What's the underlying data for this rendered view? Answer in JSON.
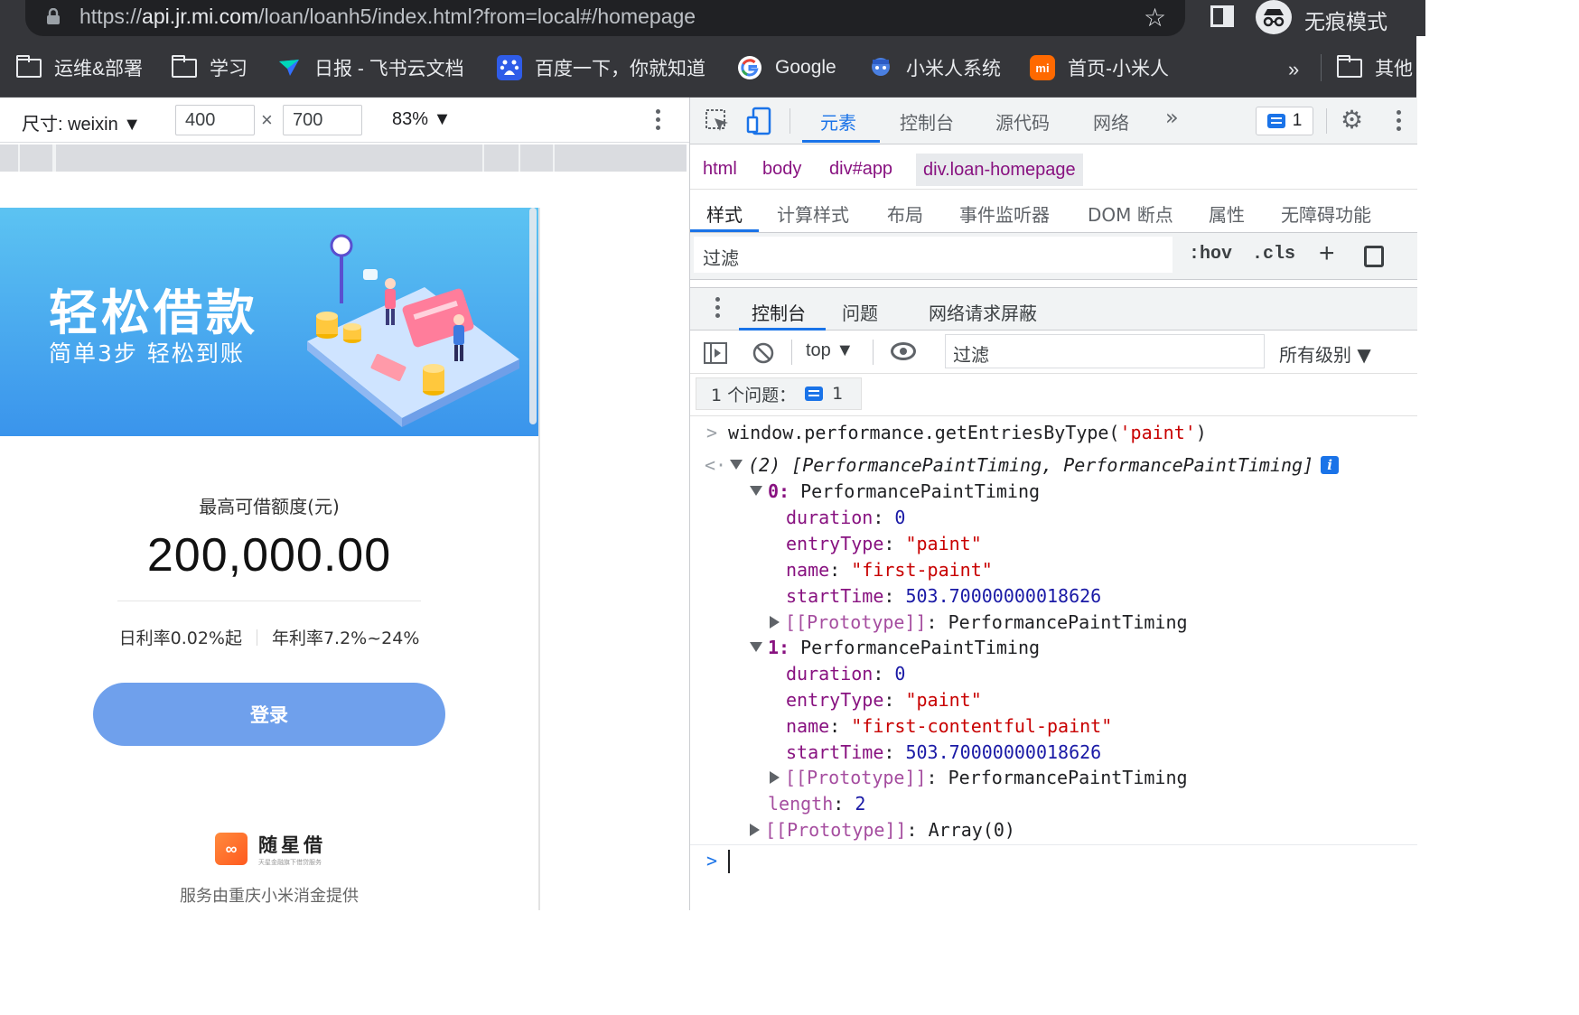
{
  "browser": {
    "url_scheme": "https://",
    "url_host": "api.jr.mi.com",
    "url_path": "/loan/loanh5/index.html?from=local#/homepage",
    "incognito_label": "无痕模式",
    "icons": [
      "lock-icon",
      "star-icon",
      "side-panel-icon",
      "incognito-icon"
    ]
  },
  "bookmarks": {
    "items": [
      {
        "label": "运维&部署",
        "icon": "folder-icon"
      },
      {
        "label": "学习",
        "icon": "folder-icon"
      },
      {
        "label": "日报 - 飞书云文档",
        "icon": "feishu-icon"
      },
      {
        "label": "百度一下，你就知道",
        "icon": "baidu-icon"
      },
      {
        "label": "Google",
        "icon": "google-icon"
      },
      {
        "label": "小米人系统",
        "icon": "mi-people-icon"
      },
      {
        "label": "首页-小米人",
        "icon": "mi-logo-icon"
      }
    ],
    "more": "»",
    "other_label": "其他"
  },
  "device_toolbar": {
    "dimensions_label": "尺寸: weixin ▼",
    "width": "400",
    "height": "700",
    "times": "×",
    "zoom": "83% ▼"
  },
  "page": {
    "banner_title": "轻松借款",
    "banner_subtitle": "简单3步   轻松到账",
    "limit_label": "最高可借额度(元)",
    "limit_value": "200,000.00",
    "daily_rate": "日利率0.02%起",
    "annual_rate": "年利率7.2%~24%",
    "login_button": "登录",
    "brand_logo": "∞",
    "brand_name": "随星借",
    "brand_tagline": "天星金融旗下借贷服务",
    "provider": "服务由重庆小米消金提供"
  },
  "devtools": {
    "tabs": [
      "元素",
      "控制台",
      "源代码",
      "网络"
    ],
    "more_tabs": "»",
    "issue_count": "1",
    "breadcrumbs": [
      "html",
      "body",
      "div#app",
      "div.loan-homepage"
    ],
    "sub_tabs": [
      "样式",
      "计算样式",
      "布局",
      "事件监听器",
      "DOM 断点",
      "属性",
      "无障碍功能"
    ],
    "styles_filter_placeholder": "过滤",
    "hov": ":hov",
    "cls": ".cls",
    "plus": "+",
    "drawer_tabs": [
      "控制台",
      "问题",
      "网络请求屏蔽"
    ],
    "context": "top ▼",
    "console_filter_placeholder": "过滤",
    "levels": "所有级别 ▼",
    "issues_text": "1 个问题：",
    "issues_count": "1"
  },
  "console": {
    "input": "window.performance.getEntriesByType(",
    "input_arg": "'paint'",
    "input_close": ")",
    "result_summary": "(2) [PerformancePaintTiming, PerformancePaintTiming]",
    "entries": [
      {
        "index": "0",
        "type": "PerformancePaintTiming",
        "duration": "0",
        "entryType": "\"paint\"",
        "name": "\"first-paint\"",
        "startTime": "503.70000000018626",
        "prototype": "PerformancePaintTiming"
      },
      {
        "index": "1",
        "type": "PerformancePaintTiming",
        "duration": "0",
        "entryType": "\"paint\"",
        "name": "\"first-contentful-paint\"",
        "startTime": "503.70000000018626",
        "prototype": "PerformancePaintTiming"
      }
    ],
    "length_key": "length",
    "length_value": "2",
    "array_prototype": "Array(0)",
    "prototype_key": "[[Prototype]]"
  }
}
